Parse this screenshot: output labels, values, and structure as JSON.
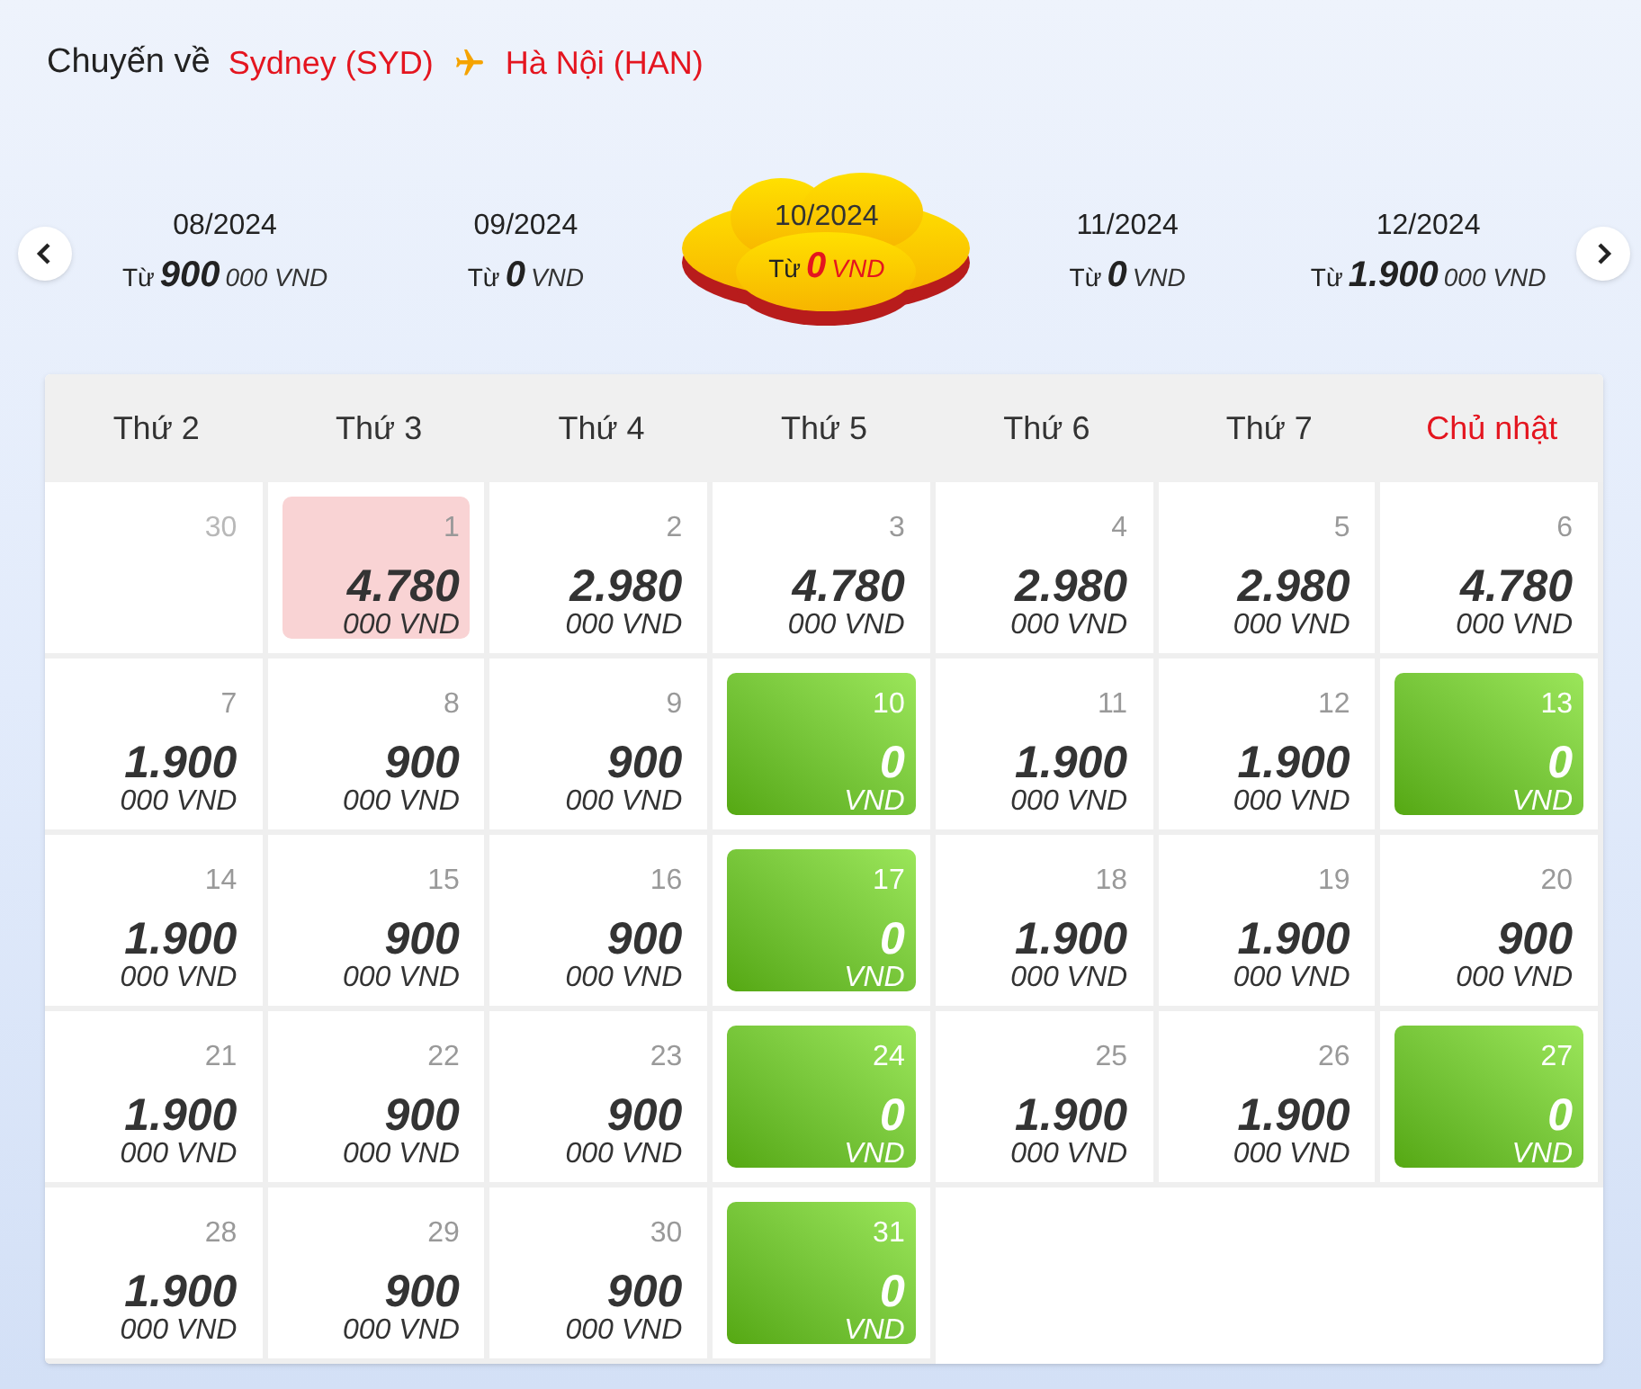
{
  "header": {
    "label": "Chuyến về",
    "origin": "Sydney (SYD)",
    "destination": "Hà Nội (HAN)"
  },
  "months": [
    {
      "label": "08/2024",
      "prefix": "Từ",
      "price": "900",
      "unit": "000 VND",
      "selected": false
    },
    {
      "label": "09/2024",
      "prefix": "Từ",
      "price": "0",
      "unit": "VND",
      "selected": false
    },
    {
      "label": "10/2024",
      "prefix": "Từ",
      "price": "0",
      "unit": "VND",
      "selected": true
    },
    {
      "label": "11/2024",
      "prefix": "Từ",
      "price": "0",
      "unit": "VND",
      "selected": false
    },
    {
      "label": "12/2024",
      "prefix": "Từ",
      "price": "1.900",
      "unit": "000 VND",
      "selected": false
    }
  ],
  "weekdays": [
    {
      "label": "Thứ 2",
      "holiday": false
    },
    {
      "label": "Thứ 3",
      "holiday": false
    },
    {
      "label": "Thứ 4",
      "holiday": false
    },
    {
      "label": "Thứ 5",
      "holiday": false
    },
    {
      "label": "Thứ 6",
      "holiday": false
    },
    {
      "label": "Thứ 7",
      "holiday": false
    },
    {
      "label": "Chủ nhật",
      "holiday": true
    }
  ],
  "days": [
    {
      "day": "30",
      "kind": "outside"
    },
    {
      "day": "1",
      "kind": "selected",
      "price": "4.780",
      "unit": "000 VND"
    },
    {
      "day": "2",
      "kind": "price",
      "price": "2.980",
      "unit": "000 VND"
    },
    {
      "day": "3",
      "kind": "price",
      "price": "4.780",
      "unit": "000 VND"
    },
    {
      "day": "4",
      "kind": "price",
      "price": "2.980",
      "unit": "000 VND"
    },
    {
      "day": "5",
      "kind": "price",
      "price": "2.980",
      "unit": "000 VND"
    },
    {
      "day": "6",
      "kind": "price",
      "price": "4.780",
      "unit": "000 VND"
    },
    {
      "day": "7",
      "kind": "price",
      "price": "1.900",
      "unit": "000 VND"
    },
    {
      "day": "8",
      "kind": "price",
      "price": "900",
      "unit": "000 VND"
    },
    {
      "day": "9",
      "kind": "price",
      "price": "900",
      "unit": "000 VND"
    },
    {
      "day": "10",
      "kind": "free",
      "price": "0",
      "unit": "VND"
    },
    {
      "day": "11",
      "kind": "price",
      "price": "1.900",
      "unit": "000 VND"
    },
    {
      "day": "12",
      "kind": "price",
      "price": "1.900",
      "unit": "000 VND"
    },
    {
      "day": "13",
      "kind": "free",
      "price": "0",
      "unit": "VND"
    },
    {
      "day": "14",
      "kind": "price",
      "price": "1.900",
      "unit": "000 VND"
    },
    {
      "day": "15",
      "kind": "price",
      "price": "900",
      "unit": "000 VND"
    },
    {
      "day": "16",
      "kind": "price",
      "price": "900",
      "unit": "000 VND"
    },
    {
      "day": "17",
      "kind": "free",
      "price": "0",
      "unit": "VND"
    },
    {
      "day": "18",
      "kind": "price",
      "price": "1.900",
      "unit": "000 VND"
    },
    {
      "day": "19",
      "kind": "price",
      "price": "1.900",
      "unit": "000 VND"
    },
    {
      "day": "20",
      "kind": "price",
      "price": "900",
      "unit": "000 VND"
    },
    {
      "day": "21",
      "kind": "price",
      "price": "1.900",
      "unit": "000 VND"
    },
    {
      "day": "22",
      "kind": "price",
      "price": "900",
      "unit": "000 VND"
    },
    {
      "day": "23",
      "kind": "price",
      "price": "900",
      "unit": "000 VND"
    },
    {
      "day": "24",
      "kind": "free",
      "price": "0",
      "unit": "VND"
    },
    {
      "day": "25",
      "kind": "price",
      "price": "1.900",
      "unit": "000 VND"
    },
    {
      "day": "26",
      "kind": "price",
      "price": "1.900",
      "unit": "000 VND"
    },
    {
      "day": "27",
      "kind": "free",
      "price": "0",
      "unit": "VND"
    },
    {
      "day": "28",
      "kind": "price",
      "price": "1.900",
      "unit": "000 VND"
    },
    {
      "day": "29",
      "kind": "price",
      "price": "900",
      "unit": "000 VND"
    },
    {
      "day": "30",
      "kind": "price",
      "price": "900",
      "unit": "000 VND"
    },
    {
      "day": "31",
      "kind": "free",
      "price": "0",
      "unit": "VND"
    }
  ]
}
